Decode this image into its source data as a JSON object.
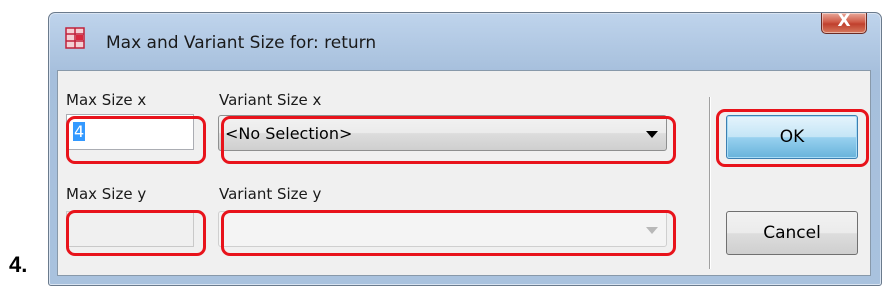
{
  "step": {
    "number": "4."
  },
  "dialog": {
    "title": "Max and Variant Size for: return",
    "close_label": "X",
    "icon": "grid-app-icon"
  },
  "form": {
    "max_size_x": {
      "label": "Max Size x",
      "value": "4"
    },
    "variant_size_x": {
      "label": "Variant Size x",
      "value": "<No Selection>"
    },
    "max_size_y": {
      "label": "Max Size y",
      "value": ""
    },
    "variant_size_y": {
      "label": "Variant Size y",
      "value": ""
    }
  },
  "buttons": {
    "ok": "OK",
    "cancel": "Cancel"
  },
  "colors": {
    "highlight": "#e8131b",
    "selection": "#3399ff"
  }
}
